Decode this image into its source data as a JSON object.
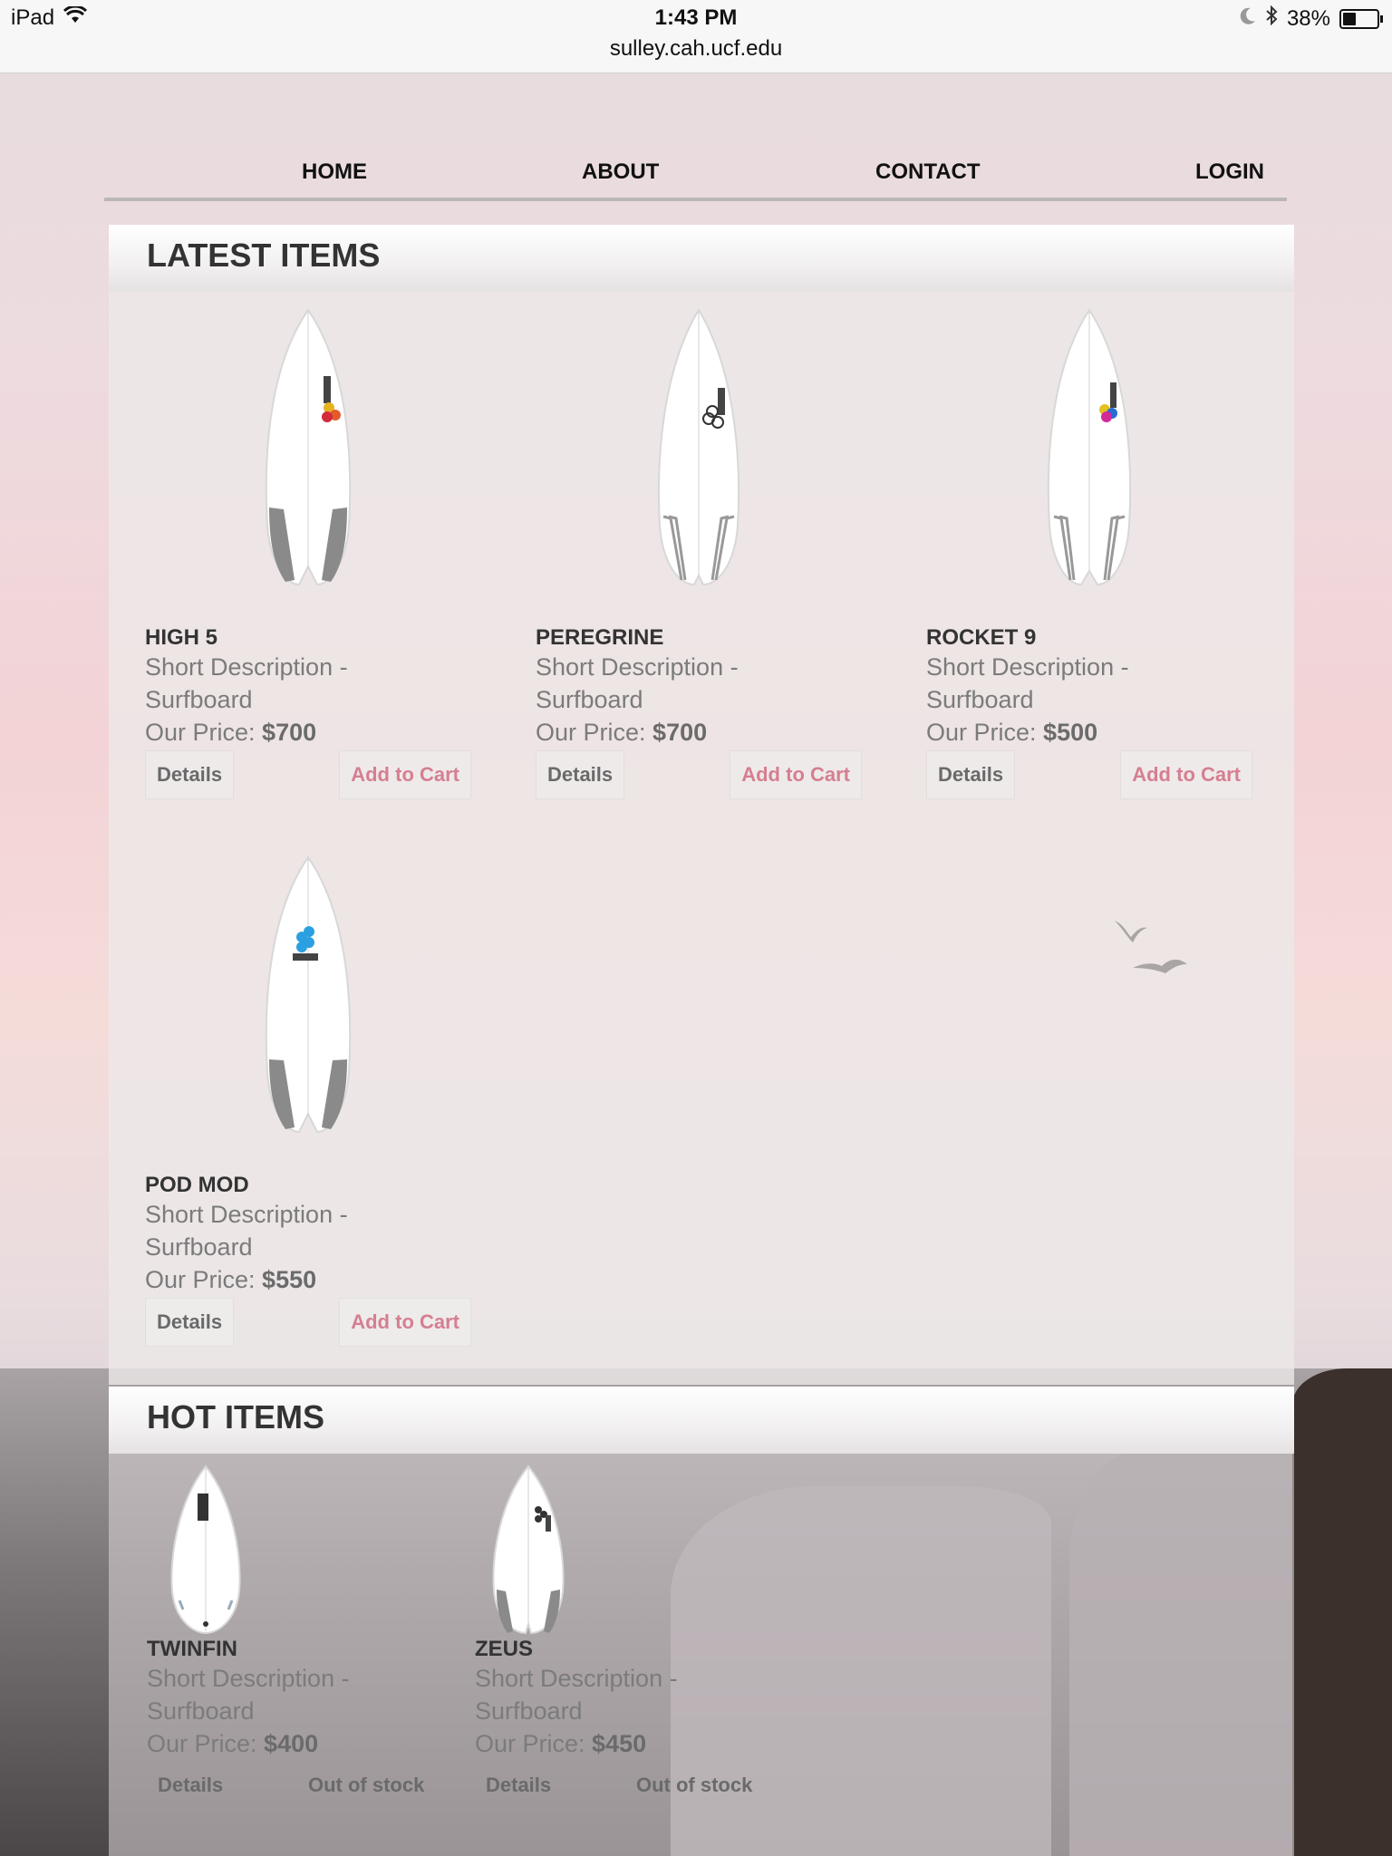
{
  "status_bar": {
    "device": "iPad",
    "time": "1:43 PM",
    "url": "sulley.cah.ucf.edu",
    "battery": "38%",
    "battery_level": 0.38,
    "icons": [
      "wifi-icon",
      "moon-icon",
      "bluetooth-icon",
      "battery-icon"
    ]
  },
  "nav": {
    "items": [
      "HOME",
      "ABOUT",
      "CONTACT",
      "LOGIN"
    ]
  },
  "latest": {
    "title": "LATEST ITEMS",
    "products": [
      {
        "name": "HIGH 5",
        "desc": "Short Description - Surfboard",
        "price_label": "Our Price:",
        "price": "$700",
        "details": "Details",
        "action": "Add to Cart"
      },
      {
        "name": "PEREGRINE",
        "desc": "Short Description - Surfboard",
        "price_label": "Our Price:",
        "price": "$700",
        "details": "Details",
        "action": "Add to Cart"
      },
      {
        "name": "ROCKET 9",
        "desc": "Short Description - Surfboard",
        "price_label": "Our Price:",
        "price": "$500",
        "details": "Details",
        "action": "Add to Cart"
      },
      {
        "name": "POD MOD",
        "desc": "Short Description - Surfboard",
        "price_label": "Our Price:",
        "price": "$550",
        "details": "Details",
        "action": "Add to Cart"
      }
    ]
  },
  "hot": {
    "title": "HOT ITEMS",
    "products": [
      {
        "name": "TWINFIN",
        "desc": "Short Description - Surfboard",
        "price_label": "Our Price:",
        "price": "$400",
        "details": "Details",
        "action": "Out of stock"
      },
      {
        "name": "ZEUS",
        "desc": "Short Description - Surfboard",
        "price_label": "Our Price:",
        "price": "$450",
        "details": "Details",
        "action": "Out of stock"
      }
    ]
  },
  "colors": {
    "accent_cart": "#d57f91",
    "text_dark": "#333333",
    "text_muted": "#7b7b7b"
  }
}
